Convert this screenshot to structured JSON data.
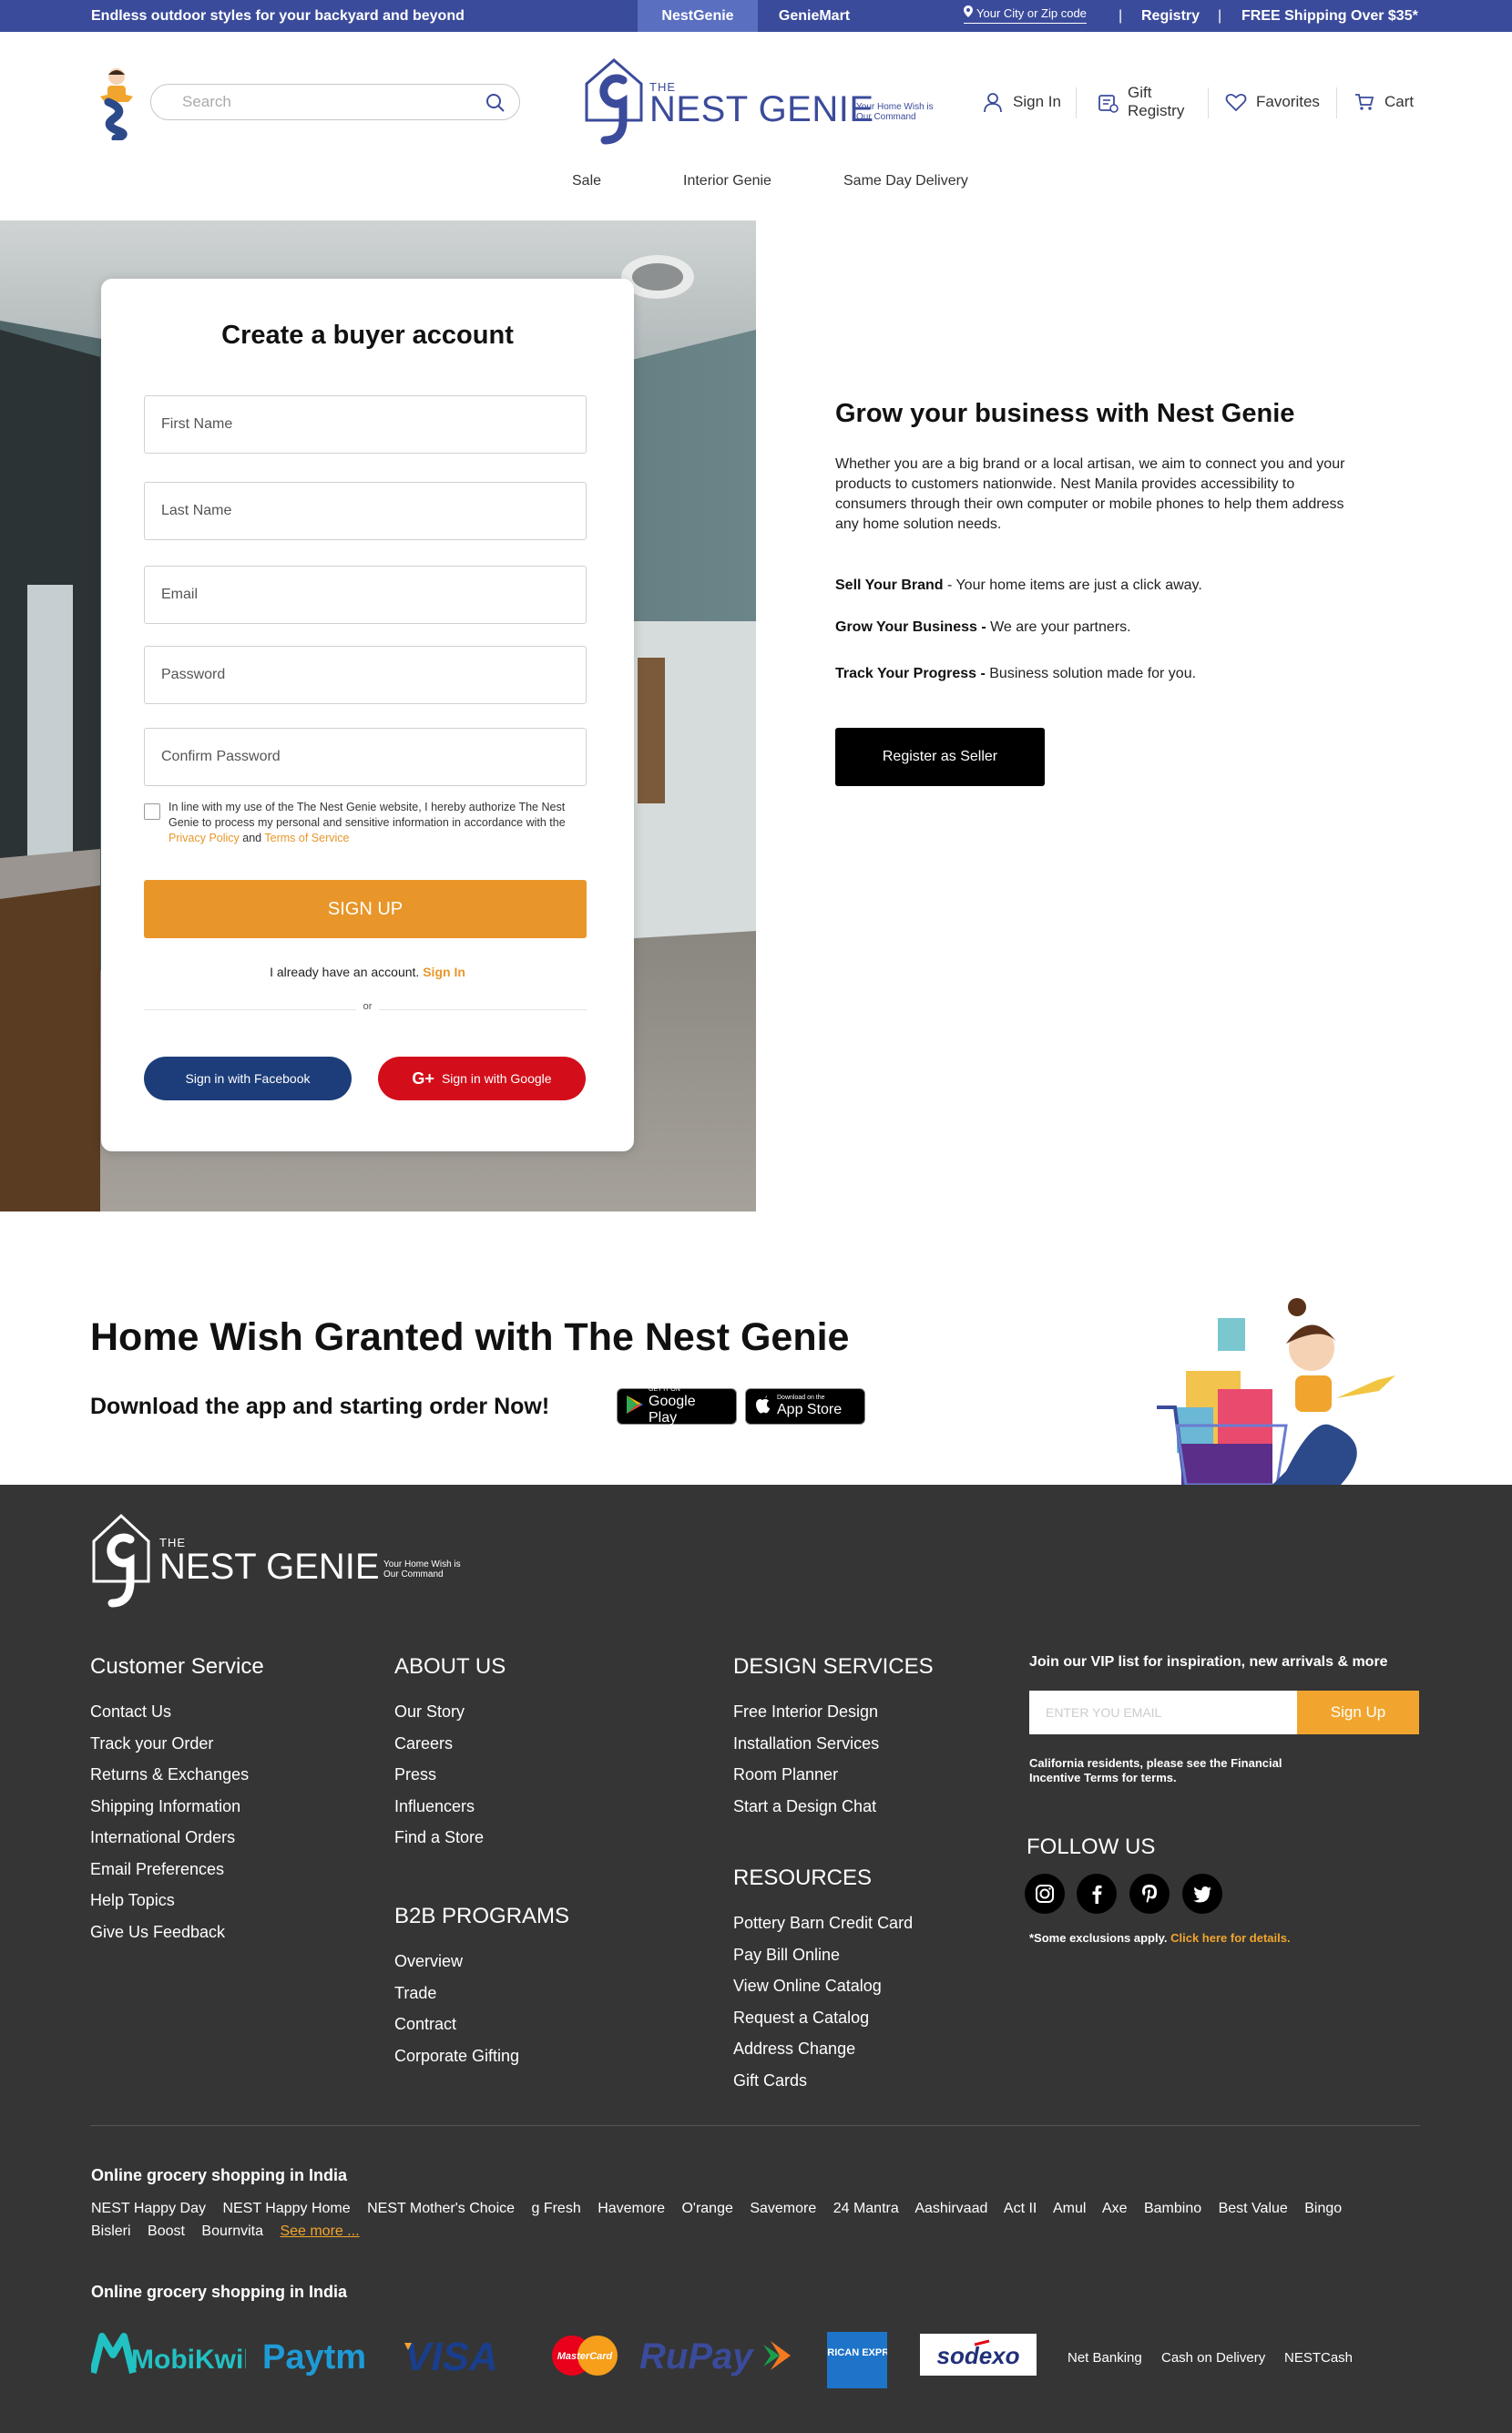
{
  "topbar": {
    "promo": "Endless outdoor styles for your backyard and beyond",
    "tabs": [
      "NestGenie",
      "GenieMart"
    ],
    "location": "Your City or Zip code",
    "registry": "Registry",
    "shipping": "FREE Shipping Over $35*",
    "separator": "|"
  },
  "header": {
    "search_placeholder": "Search",
    "logo": {
      "the": "THE",
      "name": "NEST GENIE",
      "tagline": "Your Home Wish is Our Command"
    },
    "sign_in": "Sign In",
    "gift_registry": "Gift Registry",
    "favorites": "Favorites",
    "cart": "Cart"
  },
  "nav": [
    "Sale",
    "Interior Genie",
    "Same Day Delivery"
  ],
  "signup_card": {
    "title": "Create a buyer account",
    "fields": {
      "first_name": "First Name",
      "last_name": "Last Name",
      "email": "Email",
      "password": "Password",
      "confirm_password": "Confirm Password"
    },
    "consent_text": "In line with my use of the The Nest Genie website, I hereby authorize The Nest Genie to process my personal and sensitive information in accordance with the",
    "privacy_policy": "Privacy Policy",
    "and": "and",
    "terms": "Terms of Service",
    "signup_button": "SIGN UP",
    "already": "I already have an account.",
    "sign_in_link": "Sign In",
    "or": "or",
    "facebook": "Sign in with Facebook",
    "google": "Sign in with Google",
    "google_glyph": "G+"
  },
  "business": {
    "title": "Grow your business with Nest Genie",
    "lead": "Whether you are a big brand or a local artisan, we aim to connect you and your products to customers nationwide. Nest Manila provides accessibility to consumers through their own computer or mobile phones to help them address any home solution needs.",
    "points": [
      {
        "title": "Sell Your Brand",
        "text": " - Your home items are just a click away."
      },
      {
        "title": "Grow Your Business -",
        "text": " We are your partners."
      },
      {
        "title": "Track Your Progress -",
        "text": " Business solution made for you."
      }
    ],
    "seller_button": "Register as Seller"
  },
  "app": {
    "heading": "Home Wish Granted with The Nest Genie",
    "subheading": "Download the app and starting order Now!",
    "google_small": "GET IT ON",
    "google_big": "Google Play",
    "apple_small": "Download on the",
    "apple_big": "App Store"
  },
  "footer": {
    "logo": {
      "the": "THE",
      "name": "NEST GENIE",
      "tagline": "Your Home Wish is Our Command"
    },
    "customer_service": {
      "title": "Customer Service",
      "items": [
        "Contact Us",
        "Track your Order",
        "Returns & Exchanges",
        "Shipping Information",
        "International Orders",
        "Email Preferences",
        "Help Topics",
        "Give Us Feedback"
      ]
    },
    "about_us": {
      "title": "ABOUT US",
      "items": [
        "Our Story",
        "Careers",
        "Press",
        "Influencers",
        "Find a Store"
      ]
    },
    "b2b": {
      "title": "B2B PROGRAMS",
      "items": [
        "Overview",
        "Trade",
        "Contract",
        "Corporate Gifting"
      ]
    },
    "design_services": {
      "title": "DESIGN SERVICES",
      "items": [
        "Free Interior Design",
        "Installation Services",
        "Room Planner",
        "Start a Design Chat"
      ]
    },
    "resources": {
      "title": "RESOURCES",
      "items": [
        "Pottery Barn Credit Card",
        "Pay Bill Online",
        "View Online Catalog",
        "Request a Catalog",
        "Address Change",
        "Gift Cards"
      ]
    },
    "vip_title": "Join our VIP list for inspiration, new arrivals & more",
    "vip_placeholder": "ENTER YOU EMAIL",
    "vip_button": "Sign Up",
    "california": "California residents, please see the Financial Incentive Terms for terms.",
    "follow_us": "FOLLOW US",
    "exclusions": "*Some exclusions apply.",
    "details_link": "Click here for details.",
    "grocery_title_1": "Online grocery shopping in India",
    "brands": [
      "NEST Happy Day",
      "NEST Happy Home",
      "NEST Mother's Choice",
      "g Fresh",
      "Havemore",
      "O'range",
      "Savemore",
      "24 Mantra",
      "Aashirvaad",
      "Act II",
      "Amul",
      "Axe",
      "Bambino",
      "Best Value",
      "Bingo",
      "Bisleri",
      "Boost",
      "Bournvita"
    ],
    "see_more": "See more ...",
    "grocery_title_2": "Online grocery shopping in India",
    "payments": {
      "mobikwik": "MobiKwik",
      "paytm": "Paytm",
      "visa": "VISA",
      "mastercard": "MasterCard",
      "rupay": "RuPay",
      "amex": "AMERICAN EXPRESS",
      "sodexo": "sodexo",
      "net_banking": "Net Banking",
      "cod": "Cash on Delivery",
      "nestcash": "NESTCash"
    }
  }
}
